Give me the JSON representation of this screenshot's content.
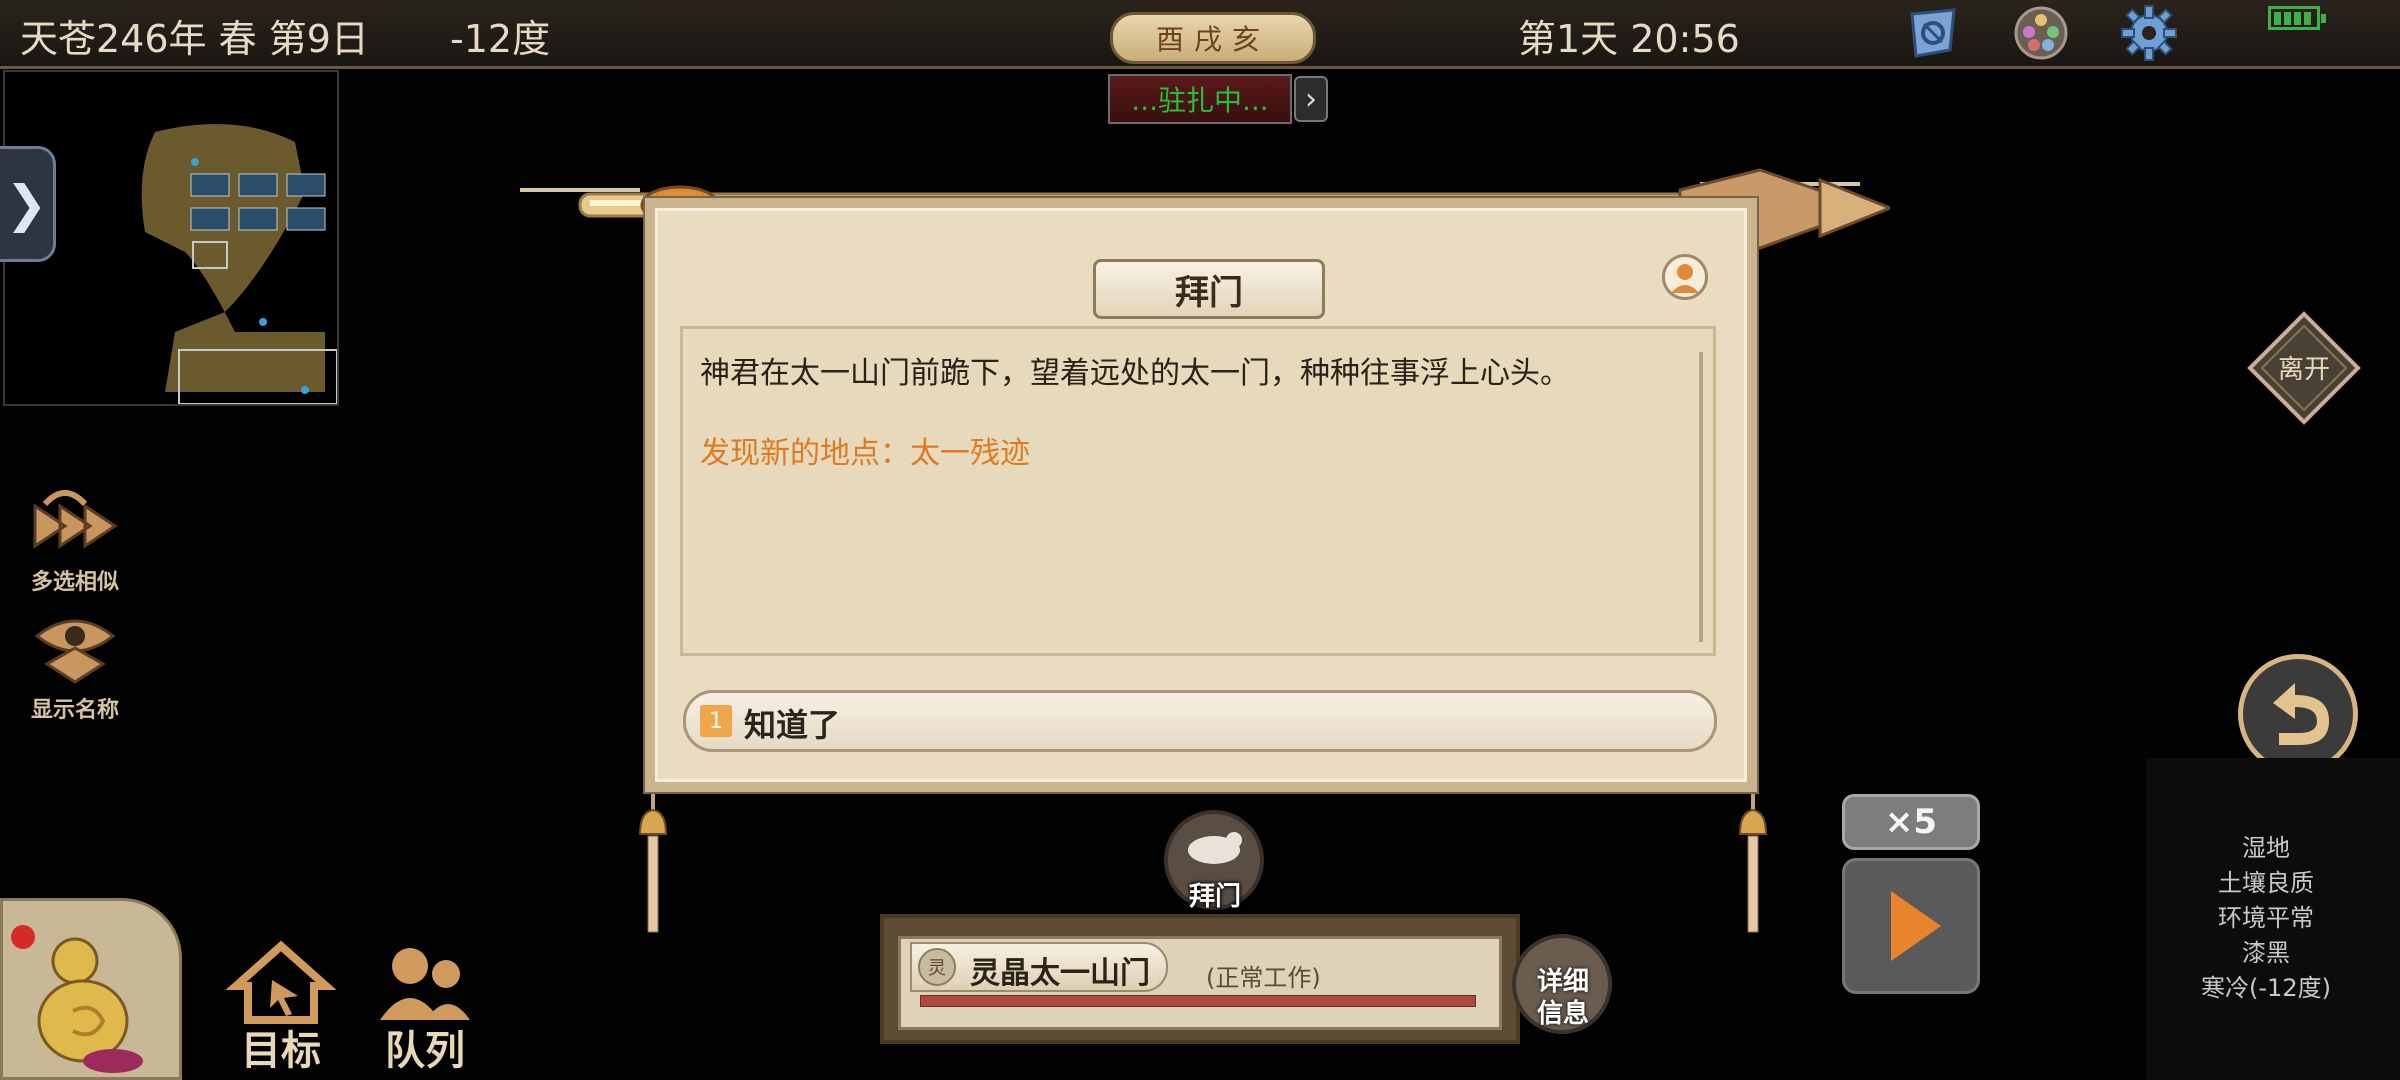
{
  "topbar": {
    "date": "天苍246年 春 第9日",
    "temperature": "-12度",
    "time_dial": "酉戌亥",
    "day_time": "第1天 20:56",
    "icons": [
      "shield-icon",
      "palette-icon",
      "gear-icon",
      "battery-icon"
    ]
  },
  "minimap": {
    "side_tab": "❯"
  },
  "banner": {
    "station": "...驻扎中...",
    "arrow": "›"
  },
  "left_actions": [
    {
      "label": "多选相似",
      "icon": "multi-select-icon"
    },
    {
      "label": "显示名称",
      "icon": "eye-icon"
    }
  ],
  "dialog": {
    "title": "拜门",
    "body": "神君在太一山门前跪下，望着远处的太一门，种种往事浮上心头。",
    "discovery": "发现新的地点：太一残迹",
    "choice": {
      "number": "1",
      "text": "知道了"
    }
  },
  "action": {
    "label": "拜门"
  },
  "location": {
    "seal": "灵",
    "name": "灵晶太一山门",
    "status": "(正常工作)",
    "progress": 1.0
  },
  "detail": {
    "label_line1": "详细",
    "label_line2": "信息"
  },
  "right_actions": {
    "leave": "离开",
    "speed": "×5"
  },
  "terrain": [
    "湿地",
    "土壤良质",
    "环境平常",
    "漆黑",
    "寒冷(-12度)"
  ],
  "bottom_nav": [
    {
      "label": "目标",
      "icon": "target-icon"
    },
    {
      "label": "队列",
      "icon": "queue-icon"
    }
  ],
  "colors": {
    "discovery_text": "#e07a22",
    "station_text": "#22c33c",
    "panel_bg": "#e9dcc0",
    "accent_gold": "#d8b57e"
  }
}
